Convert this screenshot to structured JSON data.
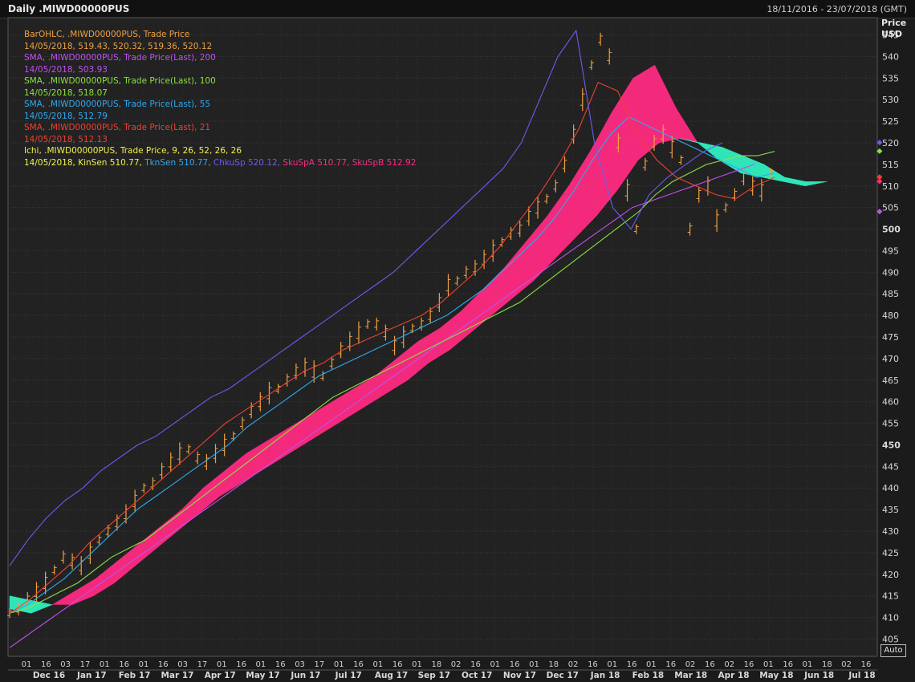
{
  "header": {
    "title": "Daily .MIWD00000PUS",
    "date_range": "18/11/2016 - 23/07/2018 (GMT)"
  },
  "price_axis": {
    "label_line1": "Price",
    "label_line2": "USD"
  },
  "auto_button": "Auto",
  "legend": [
    {
      "text": "BarOHLC, .MIWD00000PUS, Trade Price",
      "color": "#f0a040"
    },
    {
      "text": "14/05/2018, 519.43, 520.32, 519.36, 520.12",
      "color": "#f0a040"
    },
    {
      "text": "SMA, .MIWD00000PUS, Trade Price(Last),  200",
      "color": "#c050f0"
    },
    {
      "text": "14/05/2018, 503.93",
      "color": "#c050f0"
    },
    {
      "text": "SMA, .MIWD00000PUS, Trade Price(Last),  100",
      "color": "#8ce040"
    },
    {
      "text": "14/05/2018, 518.07",
      "color": "#8ce040"
    },
    {
      "text": "SMA, .MIWD00000PUS, Trade Price(Last),  55",
      "color": "#30a8f0"
    },
    {
      "text": "14/05/2018, 512.79",
      "color": "#30a8f0"
    },
    {
      "text": "SMA, .MIWD00000PUS, Trade Price(Last),  21",
      "color": "#f04030"
    },
    {
      "text": "14/05/2018, 512.13",
      "color": "#f04030"
    },
    {
      "text": "Ichi, .MIWD00000PUS, Trade Price,  9, 26, 52, 26, 26",
      "color": "#f0f050"
    },
    {
      "text": "14/05/2018, KinSen 510.77, TknSen 510.77, ChkuSp 520.12, SkuSpA 510.77, SkuSpB 512.92",
      "color": "#f0f050",
      "parts": [
        {
          "text": "14/05/2018, KinSen 510.77, ",
          "color": "#f0f050"
        },
        {
          "text": "TknSen 510.77, ",
          "color": "#30a8f0"
        },
        {
          "text": "ChkuSp 520.12, ",
          "color": "#6a5cf0"
        },
        {
          "text": "SkuSpA 510.77, ",
          "color": "#ff2a80"
        },
        {
          "text": "SkuSpB 512.92",
          "color": "#ff2a80"
        }
      ]
    }
  ],
  "chart_data": {
    "type": "line",
    "title": "Daily .MIWD00000PUS",
    "ylabel": "Price USD",
    "ylim": [
      401,
      549
    ],
    "y_ticks": [
      405,
      410,
      415,
      420,
      425,
      430,
      435,
      440,
      445,
      450,
      455,
      460,
      465,
      470,
      475,
      480,
      485,
      490,
      495,
      500,
      505,
      510,
      515,
      520,
      525,
      530,
      535,
      540,
      545
    ],
    "y_major_ticks": [
      450,
      500
    ],
    "x_day_ticks": [
      "01",
      "16",
      "03",
      "17",
      "01",
      "16",
      "01",
      "16",
      "03",
      "17",
      "01",
      "16",
      "01",
      "16",
      "03",
      "17",
      "01",
      "16",
      "01",
      "16",
      "01",
      "18",
      "02",
      "16",
      "01",
      "16",
      "01",
      "18",
      "02",
      "16",
      "01",
      "16",
      "01",
      "16",
      "02",
      "16",
      "02",
      "16",
      "01",
      "16",
      "01",
      "18",
      "02",
      "16"
    ],
    "x_month_labels": [
      "Dec 16",
      "Jan 17",
      "Feb 17",
      "Mar 17",
      "Apr 17",
      "May 17",
      "Jun 17",
      "Jul 17",
      "Aug 17",
      "Sep 17",
      "Oct 17",
      "Nov 17",
      "Dec 17",
      "Jan 18",
      "Feb 18",
      "Mar 18",
      "Apr 18",
      "May 18",
      "Jun 18",
      "Jul 18"
    ],
    "grid": true,
    "series": [
      {
        "name": "BarOHLC Trade Price",
        "color": "#f0a040",
        "values": [
          411,
          412,
          414,
          416,
          418,
          421,
          424,
          423,
          422,
          425,
          428,
          430,
          432,
          434,
          437,
          440,
          441,
          444,
          446,
          448,
          449,
          447,
          446,
          448,
          450,
          452,
          455,
          458,
          460,
          462,
          463,
          465,
          467,
          468,
          467,
          466,
          469,
          472,
          474,
          476,
          478,
          478,
          476,
          473,
          475,
          477,
          478,
          480,
          483,
          487,
          488,
          490,
          491,
          493,
          495,
          497,
          499,
          500,
          503,
          505,
          507,
          510,
          515,
          522,
          530,
          538,
          544,
          540,
          520,
          509,
          500,
          515,
          520,
          522,
          519,
          516,
          500,
          508,
          510,
          502,
          505,
          508,
          512,
          510,
          509,
          513
        ]
      },
      {
        "name": "SMA 200",
        "color": "#c050f0",
        "values": [
          403,
          405,
          407,
          409,
          411,
          413,
          415,
          417,
          419,
          421,
          423,
          425,
          427,
          429,
          431,
          433,
          435,
          437,
          439,
          441,
          443,
          445,
          447,
          449,
          451,
          453,
          455,
          457,
          459,
          461,
          463,
          465,
          467,
          469,
          471,
          473,
          475,
          477,
          479,
          481,
          483,
          485,
          487,
          489,
          491,
          493,
          495,
          497,
          499,
          501,
          503,
          505,
          506,
          507,
          508,
          509,
          510,
          511,
          512,
          513,
          514,
          515
        ]
      },
      {
        "name": "SMA 100",
        "color": "#8ce040",
        "values": [
          411,
          412,
          414,
          416,
          418,
          421,
          424,
          426,
          428,
          431,
          434,
          437,
          440,
          443,
          446,
          449,
          452,
          455,
          458,
          461,
          463,
          465,
          467,
          469,
          471,
          473,
          475,
          477,
          479,
          481,
          483,
          486,
          489,
          492,
          495,
          498,
          501,
          504,
          508,
          511,
          513,
          515,
          516,
          517,
          517,
          518
        ]
      },
      {
        "name": "SMA 55",
        "color": "#30a8f0",
        "values": [
          411,
          413,
          416,
          419,
          423,
          427,
          431,
          435,
          438,
          441,
          444,
          447,
          450,
          454,
          457,
          460,
          463,
          466,
          468,
          470,
          472,
          474,
          476,
          478,
          480,
          483,
          486,
          490,
          494,
          498,
          503,
          509,
          516,
          522,
          526,
          524,
          522,
          520,
          518,
          516,
          514,
          512,
          513
        ]
      },
      {
        "name": "SMA 21",
        "color": "#f04030",
        "values": [
          411,
          414,
          418,
          422,
          427,
          431,
          435,
          439,
          443,
          447,
          451,
          455,
          458,
          461,
          464,
          467,
          469,
          472,
          474,
          476,
          478,
          480,
          483,
          487,
          491,
          496,
          502,
          508,
          515,
          523,
          534,
          532,
          522,
          516,
          512,
          510,
          508,
          507,
          510,
          512
        ]
      },
      {
        "name": "Ichimoku Cloud A",
        "color": "#ff2a80",
        "values": [
          412,
          411,
          413,
          416,
          419,
          423,
          427,
          431,
          435,
          440,
          444,
          448,
          451,
          454,
          457,
          460,
          463,
          466,
          470,
          474,
          477,
          481,
          486,
          491,
          497,
          503,
          510,
          518,
          527,
          535,
          538,
          528,
          520,
          516,
          513,
          512,
          511,
          510,
          511
        ]
      },
      {
        "name": "Ichimoku Cloud B",
        "color": "#30f0c0",
        "values": [
          415,
          414,
          413,
          413,
          415,
          418,
          422,
          426,
          430,
          434,
          438,
          441,
          444,
          447,
          450,
          453,
          456,
          459,
          462,
          465,
          469,
          472,
          476,
          480,
          484,
          488,
          493,
          498,
          503,
          509,
          516,
          520,
          521,
          520,
          519,
          517,
          515,
          512,
          511,
          512
        ]
      },
      {
        "name": "Ichimoku Chikou",
        "color": "#6a5cf0",
        "values": [
          422,
          428,
          433,
          437,
          440,
          444,
          447,
          450,
          452,
          455,
          458,
          461,
          463,
          466,
          469,
          472,
          475,
          478,
          481,
          484,
          487,
          490,
          494,
          498,
          502,
          506,
          510,
          514,
          520,
          530,
          540,
          546,
          520,
          505,
          500,
          508,
          512,
          515,
          518,
          520
        ]
      }
    ]
  }
}
